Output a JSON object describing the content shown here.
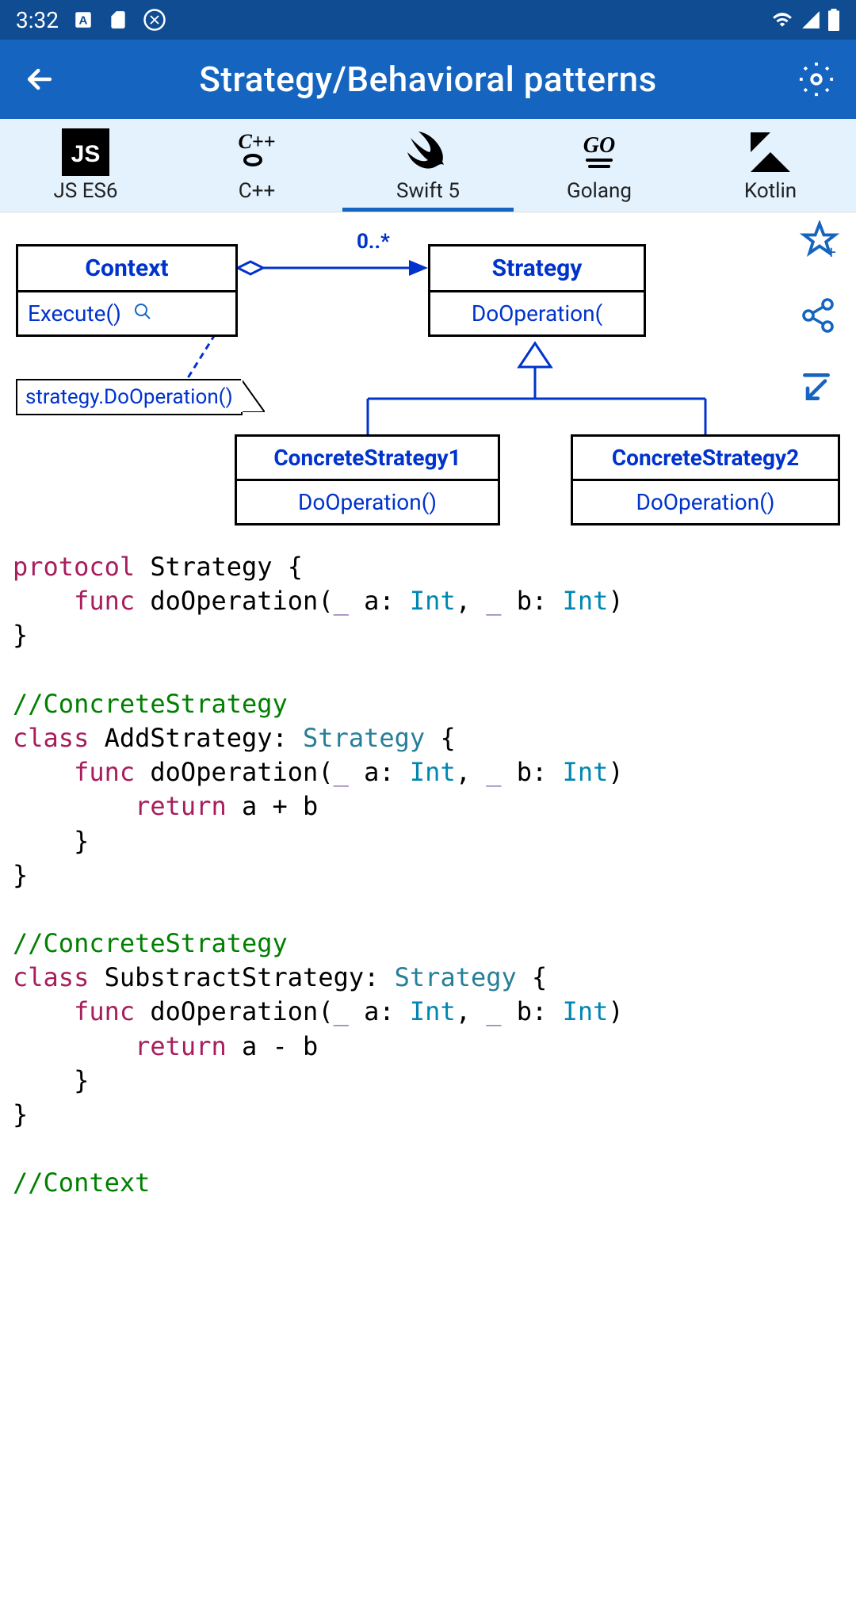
{
  "status": {
    "time": "3:32"
  },
  "header": {
    "title": "Strategy/Behavioral patterns"
  },
  "tabs": [
    {
      "label": "JS ES6",
      "active": false,
      "icon": "JS"
    },
    {
      "label": "C++",
      "active": false,
      "icon": "C++"
    },
    {
      "label": "Swift 5",
      "active": true,
      "icon": "swift"
    },
    {
      "label": "Golang",
      "active": false,
      "icon": "GO"
    },
    {
      "label": "Kotlin",
      "active": false,
      "icon": "K"
    }
  ],
  "diagram": {
    "context": {
      "title": "Context",
      "method": "Execute()"
    },
    "strategy": {
      "title": "Strategy",
      "method": "DoOperation("
    },
    "concrete1": {
      "title": "ConcreteStrategy1",
      "method": "DoOperation()"
    },
    "concrete2": {
      "title": "ConcreteStrategy2",
      "method": "DoOperation()"
    },
    "note": "strategy.DoOperation()",
    "multiplicity": "0..*"
  },
  "code": {
    "tokens": [
      [
        {
          "t": "protocol",
          "c": "kw-magenta"
        },
        {
          "t": " Strategy {",
          "c": ""
        }
      ],
      [
        {
          "t": "    ",
          "c": ""
        },
        {
          "t": "func",
          "c": "kw-magenta"
        },
        {
          "t": " doOperation(",
          "c": ""
        },
        {
          "t": "_",
          "c": "kw-purple"
        },
        {
          "t": " a: ",
          "c": ""
        },
        {
          "t": "Int",
          "c": "kw-teal"
        },
        {
          "t": ", ",
          "c": ""
        },
        {
          "t": "_",
          "c": "kw-purple"
        },
        {
          "t": " b: ",
          "c": ""
        },
        {
          "t": "Int",
          "c": "kw-teal"
        },
        {
          "t": ")",
          "c": ""
        }
      ],
      [
        {
          "t": "}",
          "c": ""
        }
      ],
      [],
      [
        {
          "t": "//ConcreteStrategy",
          "c": "cmt"
        }
      ],
      [
        {
          "t": "class",
          "c": "kw-magenta"
        },
        {
          "t": " AddStrategy: ",
          "c": ""
        },
        {
          "t": "Strategy",
          "c": "typ"
        },
        {
          "t": " {",
          "c": ""
        }
      ],
      [
        {
          "t": "    ",
          "c": ""
        },
        {
          "t": "func",
          "c": "kw-magenta"
        },
        {
          "t": " doOperation(",
          "c": ""
        },
        {
          "t": "_",
          "c": "kw-purple"
        },
        {
          "t": " a: ",
          "c": ""
        },
        {
          "t": "Int",
          "c": "kw-teal"
        },
        {
          "t": ", ",
          "c": ""
        },
        {
          "t": "_",
          "c": "kw-purple"
        },
        {
          "t": " b: ",
          "c": ""
        },
        {
          "t": "Int",
          "c": "kw-teal"
        },
        {
          "t": ")",
          "c": ""
        }
      ],
      [
        {
          "t": "        ",
          "c": ""
        },
        {
          "t": "return",
          "c": "kw-magenta"
        },
        {
          "t": " a + b",
          "c": ""
        }
      ],
      [
        {
          "t": "    }",
          "c": ""
        }
      ],
      [
        {
          "t": "}",
          "c": ""
        }
      ],
      [],
      [
        {
          "t": "//ConcreteStrategy",
          "c": "cmt"
        }
      ],
      [
        {
          "t": "class",
          "c": "kw-magenta"
        },
        {
          "t": " SubstractStrategy: ",
          "c": ""
        },
        {
          "t": "Strategy",
          "c": "typ"
        },
        {
          "t": " {",
          "c": ""
        }
      ],
      [
        {
          "t": "    ",
          "c": ""
        },
        {
          "t": "func",
          "c": "kw-magenta"
        },
        {
          "t": " doOperation(",
          "c": ""
        },
        {
          "t": "_",
          "c": "kw-purple"
        },
        {
          "t": " a: ",
          "c": ""
        },
        {
          "t": "Int",
          "c": "kw-teal"
        },
        {
          "t": ", ",
          "c": ""
        },
        {
          "t": "_",
          "c": "kw-purple"
        },
        {
          "t": " b: ",
          "c": ""
        },
        {
          "t": "Int",
          "c": "kw-teal"
        },
        {
          "t": ")",
          "c": ""
        }
      ],
      [
        {
          "t": "        ",
          "c": ""
        },
        {
          "t": "return",
          "c": "kw-magenta"
        },
        {
          "t": " a - b",
          "c": ""
        }
      ],
      [
        {
          "t": "    }",
          "c": ""
        }
      ],
      [
        {
          "t": "}",
          "c": ""
        }
      ],
      [],
      [
        {
          "t": "//Context",
          "c": "cmt"
        }
      ]
    ]
  }
}
